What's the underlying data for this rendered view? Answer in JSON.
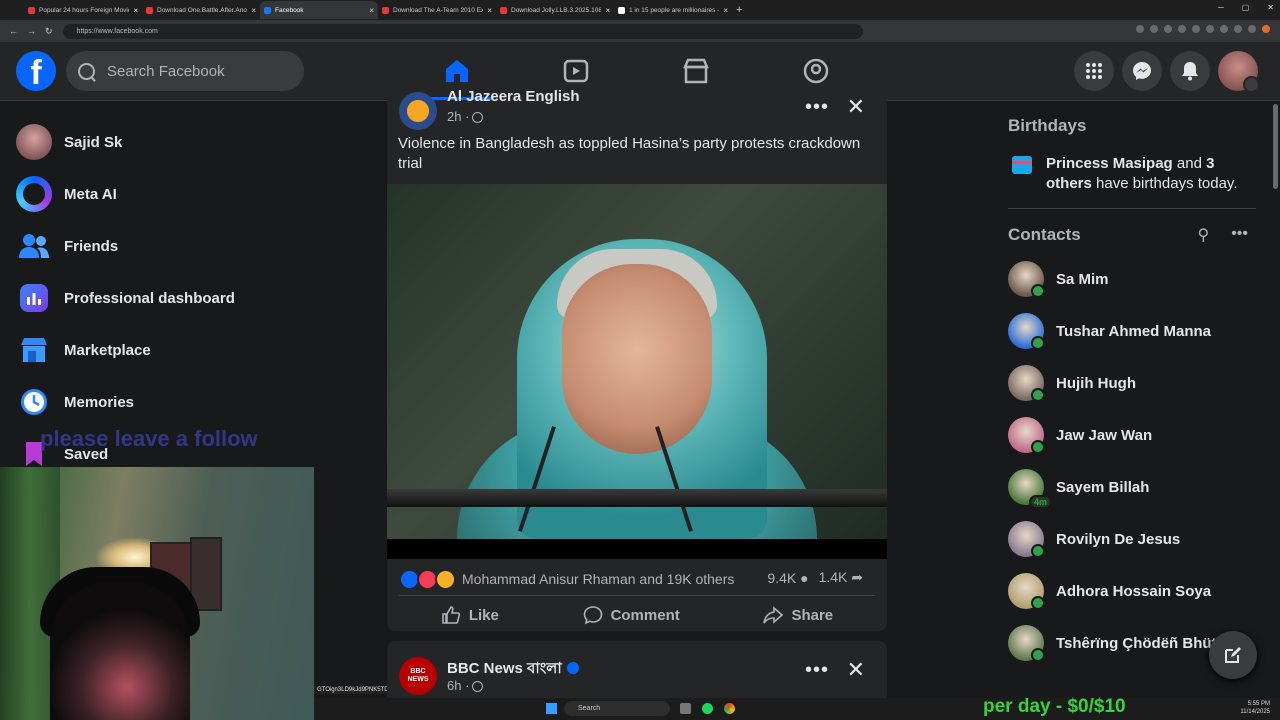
{
  "browser": {
    "tabs": [
      {
        "title": "Popular 24 hours Foreign Movie",
        "color": "#e53935",
        "active": false
      },
      {
        "title": "Download One.Battle.After.Ano",
        "color": "#e53935",
        "active": false
      },
      {
        "title": "Facebook",
        "color": "#1877f2",
        "active": true
      },
      {
        "title": "Download The A-Team 2010 Ext",
        "color": "#e53935",
        "active": false
      },
      {
        "title": "Download Jolly.LLB.3.2025.1080",
        "color": "#e53935",
        "active": false
      },
      {
        "title": "1 in 15 people are millionaires -",
        "color": "#ffffff",
        "active": false
      }
    ],
    "url": "https://www.facebook.com"
  },
  "header": {
    "logo": "f",
    "search_placeholder": "Search Facebook"
  },
  "sidebar": {
    "items": [
      {
        "label": "Sajid Sk",
        "icon": "profile-avatar"
      },
      {
        "label": "Meta AI",
        "icon": "meta-ai-icon"
      },
      {
        "label": "Friends",
        "icon": "friends-icon"
      },
      {
        "label": "Professional dashboard",
        "icon": "dashboard-icon"
      },
      {
        "label": "Marketplace",
        "icon": "marketplace-icon"
      },
      {
        "label": "Memories",
        "icon": "memories-icon"
      },
      {
        "label": "Saved",
        "icon": "saved-icon"
      }
    ],
    "overlay_text": "please leave a follow"
  },
  "post": {
    "author": "Al Jazeera English",
    "time": "2h ·",
    "text": "Violence in Bangladesh as toppled Hasina’s party protests crackdown trial",
    "reactions_text": "Mohammad Anisur Rhaman and 19K others",
    "comments": "9.4K",
    "shares": "1.4K",
    "like_label": "Like",
    "comment_label": "Comment",
    "share_label": "Share"
  },
  "post2": {
    "author": "BBC News বাংলা",
    "time": "6h ·",
    "avatar_text": "BBC NEWS"
  },
  "birthdays": {
    "heading": "Birthdays",
    "name": "Princess Masipag",
    "and": "and",
    "others": "3 others",
    "rest": "have birthdays today."
  },
  "contacts": {
    "heading": "Contacts",
    "list": [
      {
        "name": "Sa Mim",
        "online": true,
        "badge": ""
      },
      {
        "name": "Tushar Ahmed Manna",
        "online": true,
        "badge": ""
      },
      {
        "name": "Hujih Hugh",
        "online": true,
        "badge": ""
      },
      {
        "name": "Jaw Jaw Wan",
        "online": true,
        "badge": ""
      },
      {
        "name": "Sayem Billah",
        "online": false,
        "badge": "4m"
      },
      {
        "name": "Rovilyn De Jesus",
        "online": true,
        "badge": ""
      },
      {
        "name": "Adhora Hossain Soya",
        "online": true,
        "badge": ""
      },
      {
        "name": "Tshêrïng Çhödëñ Bhütïa",
        "online": true,
        "badge": ""
      }
    ]
  },
  "stream": {
    "donation_text": "GTOign3LD9kJd9PNK5TDne4VFphtE1DJ...",
    "per_day": "per day - $0/$10"
  },
  "taskbar": {
    "search": "Search",
    "time": "5:55 PM",
    "date": "11/14/2025"
  }
}
